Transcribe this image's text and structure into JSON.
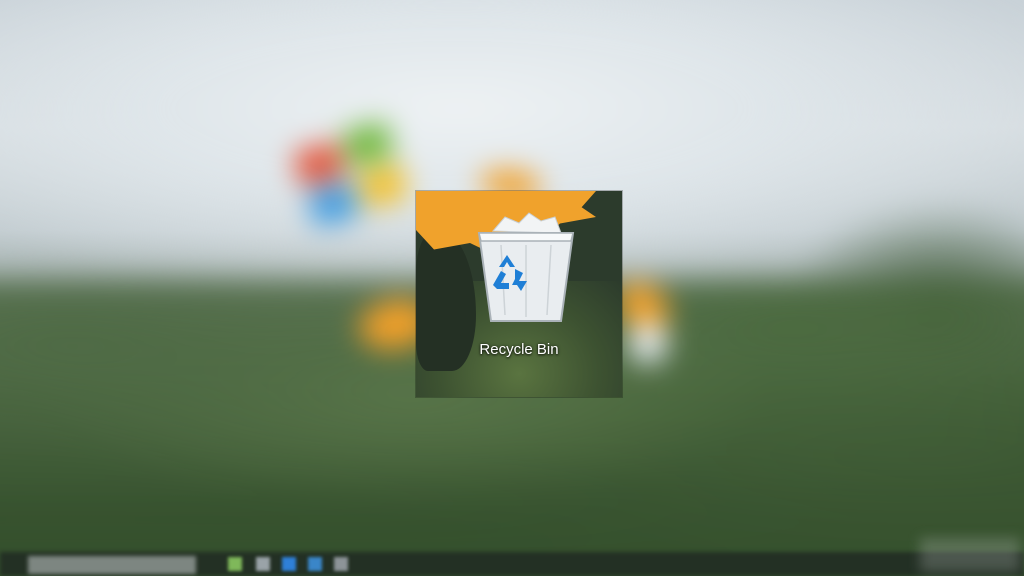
{
  "desktop": {
    "recycle_bin": {
      "label": "Recycle Bin",
      "icon": "recycle-bin-icon"
    }
  },
  "taskbar": {
    "search_placeholder": "",
    "pinned_icons": [
      "app-icon-green",
      "app-icon-gray",
      "app-icon-blue",
      "app-icon-blue-2",
      "app-icon-gray-2"
    ]
  },
  "colors": {
    "windows_red": "#e2543a",
    "windows_green": "#6fb83c",
    "windows_blue": "#3e9be0",
    "windows_yellow": "#f2c12e",
    "recycle_arrow_blue": "#1f7fd6",
    "accent_orange": "#f0a22c"
  }
}
